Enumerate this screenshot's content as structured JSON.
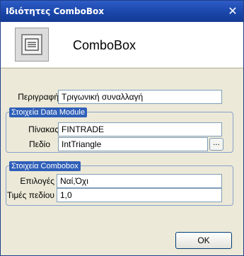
{
  "window": {
    "title": "Ιδιότητες ComboBox",
    "close_symbol": "✕"
  },
  "header": {
    "heading": "ComboBox",
    "icon": "combobox-icon"
  },
  "fields": {
    "description": {
      "label": "Περιγραφή",
      "value": "Τριγωνική συναλλαγή"
    }
  },
  "data_module_group": {
    "legend": "Στοιχεία Data Module",
    "table": {
      "label": "Πίνακας",
      "value": "FINTRADE"
    },
    "field": {
      "label": "Πεδίο",
      "value": "IntTriangle"
    },
    "browse_label": "..."
  },
  "combobox_group": {
    "legend": "Στοιχεία Combobox",
    "options": {
      "label": "Επιλογές",
      "value": "Ναί,Όχι"
    },
    "field_values": {
      "label": "Τιμές πεδίου",
      "value": "1,0"
    }
  },
  "buttons": {
    "ok_label": "OK"
  }
}
